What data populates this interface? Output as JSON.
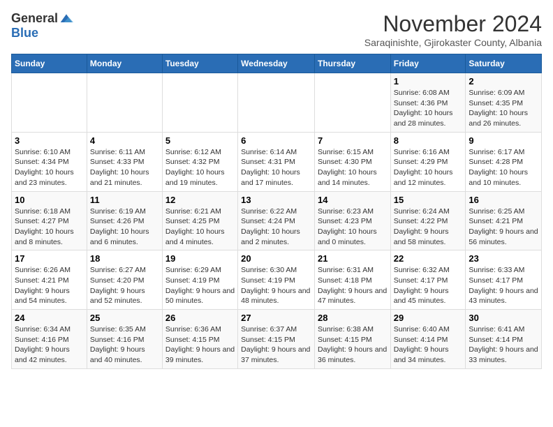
{
  "logo": {
    "general": "General",
    "blue": "Blue"
  },
  "title": "November 2024",
  "subtitle": "Saraqinishte, Gjirokaster County, Albania",
  "days_of_week": [
    "Sunday",
    "Monday",
    "Tuesday",
    "Wednesday",
    "Thursday",
    "Friday",
    "Saturday"
  ],
  "weeks": [
    [
      {
        "day": "",
        "info": ""
      },
      {
        "day": "",
        "info": ""
      },
      {
        "day": "",
        "info": ""
      },
      {
        "day": "",
        "info": ""
      },
      {
        "day": "",
        "info": ""
      },
      {
        "day": "1",
        "info": "Sunrise: 6:08 AM\nSunset: 4:36 PM\nDaylight: 10 hours and 28 minutes."
      },
      {
        "day": "2",
        "info": "Sunrise: 6:09 AM\nSunset: 4:35 PM\nDaylight: 10 hours and 26 minutes."
      }
    ],
    [
      {
        "day": "3",
        "info": "Sunrise: 6:10 AM\nSunset: 4:34 PM\nDaylight: 10 hours and 23 minutes."
      },
      {
        "day": "4",
        "info": "Sunrise: 6:11 AM\nSunset: 4:33 PM\nDaylight: 10 hours and 21 minutes."
      },
      {
        "day": "5",
        "info": "Sunrise: 6:12 AM\nSunset: 4:32 PM\nDaylight: 10 hours and 19 minutes."
      },
      {
        "day": "6",
        "info": "Sunrise: 6:14 AM\nSunset: 4:31 PM\nDaylight: 10 hours and 17 minutes."
      },
      {
        "day": "7",
        "info": "Sunrise: 6:15 AM\nSunset: 4:30 PM\nDaylight: 10 hours and 14 minutes."
      },
      {
        "day": "8",
        "info": "Sunrise: 6:16 AM\nSunset: 4:29 PM\nDaylight: 10 hours and 12 minutes."
      },
      {
        "day": "9",
        "info": "Sunrise: 6:17 AM\nSunset: 4:28 PM\nDaylight: 10 hours and 10 minutes."
      }
    ],
    [
      {
        "day": "10",
        "info": "Sunrise: 6:18 AM\nSunset: 4:27 PM\nDaylight: 10 hours and 8 minutes."
      },
      {
        "day": "11",
        "info": "Sunrise: 6:19 AM\nSunset: 4:26 PM\nDaylight: 10 hours and 6 minutes."
      },
      {
        "day": "12",
        "info": "Sunrise: 6:21 AM\nSunset: 4:25 PM\nDaylight: 10 hours and 4 minutes."
      },
      {
        "day": "13",
        "info": "Sunrise: 6:22 AM\nSunset: 4:24 PM\nDaylight: 10 hours and 2 minutes."
      },
      {
        "day": "14",
        "info": "Sunrise: 6:23 AM\nSunset: 4:23 PM\nDaylight: 10 hours and 0 minutes."
      },
      {
        "day": "15",
        "info": "Sunrise: 6:24 AM\nSunset: 4:22 PM\nDaylight: 9 hours and 58 minutes."
      },
      {
        "day": "16",
        "info": "Sunrise: 6:25 AM\nSunset: 4:21 PM\nDaylight: 9 hours and 56 minutes."
      }
    ],
    [
      {
        "day": "17",
        "info": "Sunrise: 6:26 AM\nSunset: 4:21 PM\nDaylight: 9 hours and 54 minutes."
      },
      {
        "day": "18",
        "info": "Sunrise: 6:27 AM\nSunset: 4:20 PM\nDaylight: 9 hours and 52 minutes."
      },
      {
        "day": "19",
        "info": "Sunrise: 6:29 AM\nSunset: 4:19 PM\nDaylight: 9 hours and 50 minutes."
      },
      {
        "day": "20",
        "info": "Sunrise: 6:30 AM\nSunset: 4:19 PM\nDaylight: 9 hours and 48 minutes."
      },
      {
        "day": "21",
        "info": "Sunrise: 6:31 AM\nSunset: 4:18 PM\nDaylight: 9 hours and 47 minutes."
      },
      {
        "day": "22",
        "info": "Sunrise: 6:32 AM\nSunset: 4:17 PM\nDaylight: 9 hours and 45 minutes."
      },
      {
        "day": "23",
        "info": "Sunrise: 6:33 AM\nSunset: 4:17 PM\nDaylight: 9 hours and 43 minutes."
      }
    ],
    [
      {
        "day": "24",
        "info": "Sunrise: 6:34 AM\nSunset: 4:16 PM\nDaylight: 9 hours and 42 minutes."
      },
      {
        "day": "25",
        "info": "Sunrise: 6:35 AM\nSunset: 4:16 PM\nDaylight: 9 hours and 40 minutes."
      },
      {
        "day": "26",
        "info": "Sunrise: 6:36 AM\nSunset: 4:15 PM\nDaylight: 9 hours and 39 minutes."
      },
      {
        "day": "27",
        "info": "Sunrise: 6:37 AM\nSunset: 4:15 PM\nDaylight: 9 hours and 37 minutes."
      },
      {
        "day": "28",
        "info": "Sunrise: 6:38 AM\nSunset: 4:15 PM\nDaylight: 9 hours and 36 minutes."
      },
      {
        "day": "29",
        "info": "Sunrise: 6:40 AM\nSunset: 4:14 PM\nDaylight: 9 hours and 34 minutes."
      },
      {
        "day": "30",
        "info": "Sunrise: 6:41 AM\nSunset: 4:14 PM\nDaylight: 9 hours and 33 minutes."
      }
    ]
  ]
}
